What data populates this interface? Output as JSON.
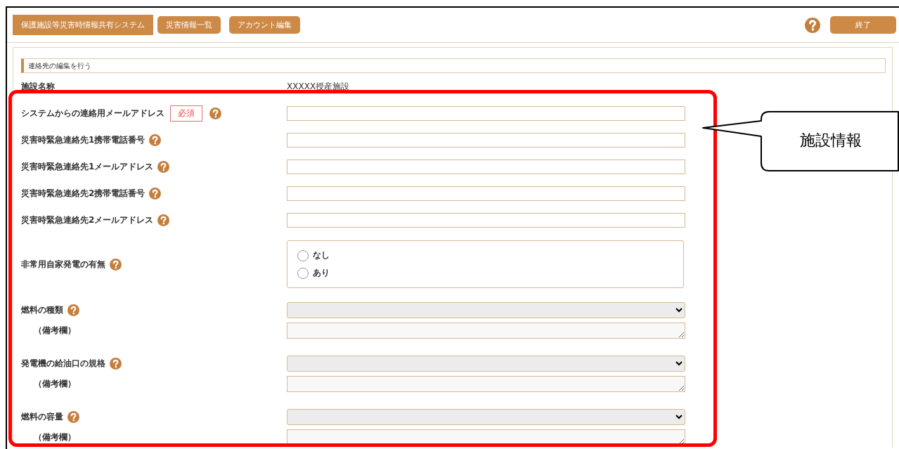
{
  "header": {
    "tabs": [
      {
        "label": "保護施設等災害時情報共有システム",
        "selected": true
      },
      {
        "label": "災害情報一覧",
        "selected": false
      },
      {
        "label": "アカウント編集",
        "selected": false
      }
    ],
    "exit_button": "終了"
  },
  "section_title": "連絡先の編集を行う",
  "facility": {
    "label": "施設名称",
    "value": "XXXXX授産施設"
  },
  "fields": [
    {
      "kind": "text",
      "label": "システムからの連絡用メールアドレス",
      "badge": "必須"
    },
    {
      "kind": "text",
      "label": "災害時緊急連絡先1携帯電話番号"
    },
    {
      "kind": "text",
      "label": "災害時緊急連絡先1メールアドレス"
    },
    {
      "kind": "text",
      "label": "災害時緊急連絡先2携帯電話番号"
    },
    {
      "kind": "text",
      "label": "災害時緊急連絡先2メールアドレス"
    },
    {
      "kind": "radio",
      "label": "非常用自家発電の有無",
      "options": [
        {
          "label": "なし",
          "selected": false
        },
        {
          "label": "あり",
          "selected": false
        }
      ]
    },
    {
      "kind": "select",
      "label": "燃料の種類",
      "note_label": "（備考欄）"
    },
    {
      "kind": "select",
      "label": "発電機の給油口の規格",
      "note_label": "（備考欄）"
    },
    {
      "kind": "select",
      "label": "燃料の容量",
      "note_label": "（備考欄）"
    }
  ],
  "callout": {
    "text": "施設情報"
  }
}
